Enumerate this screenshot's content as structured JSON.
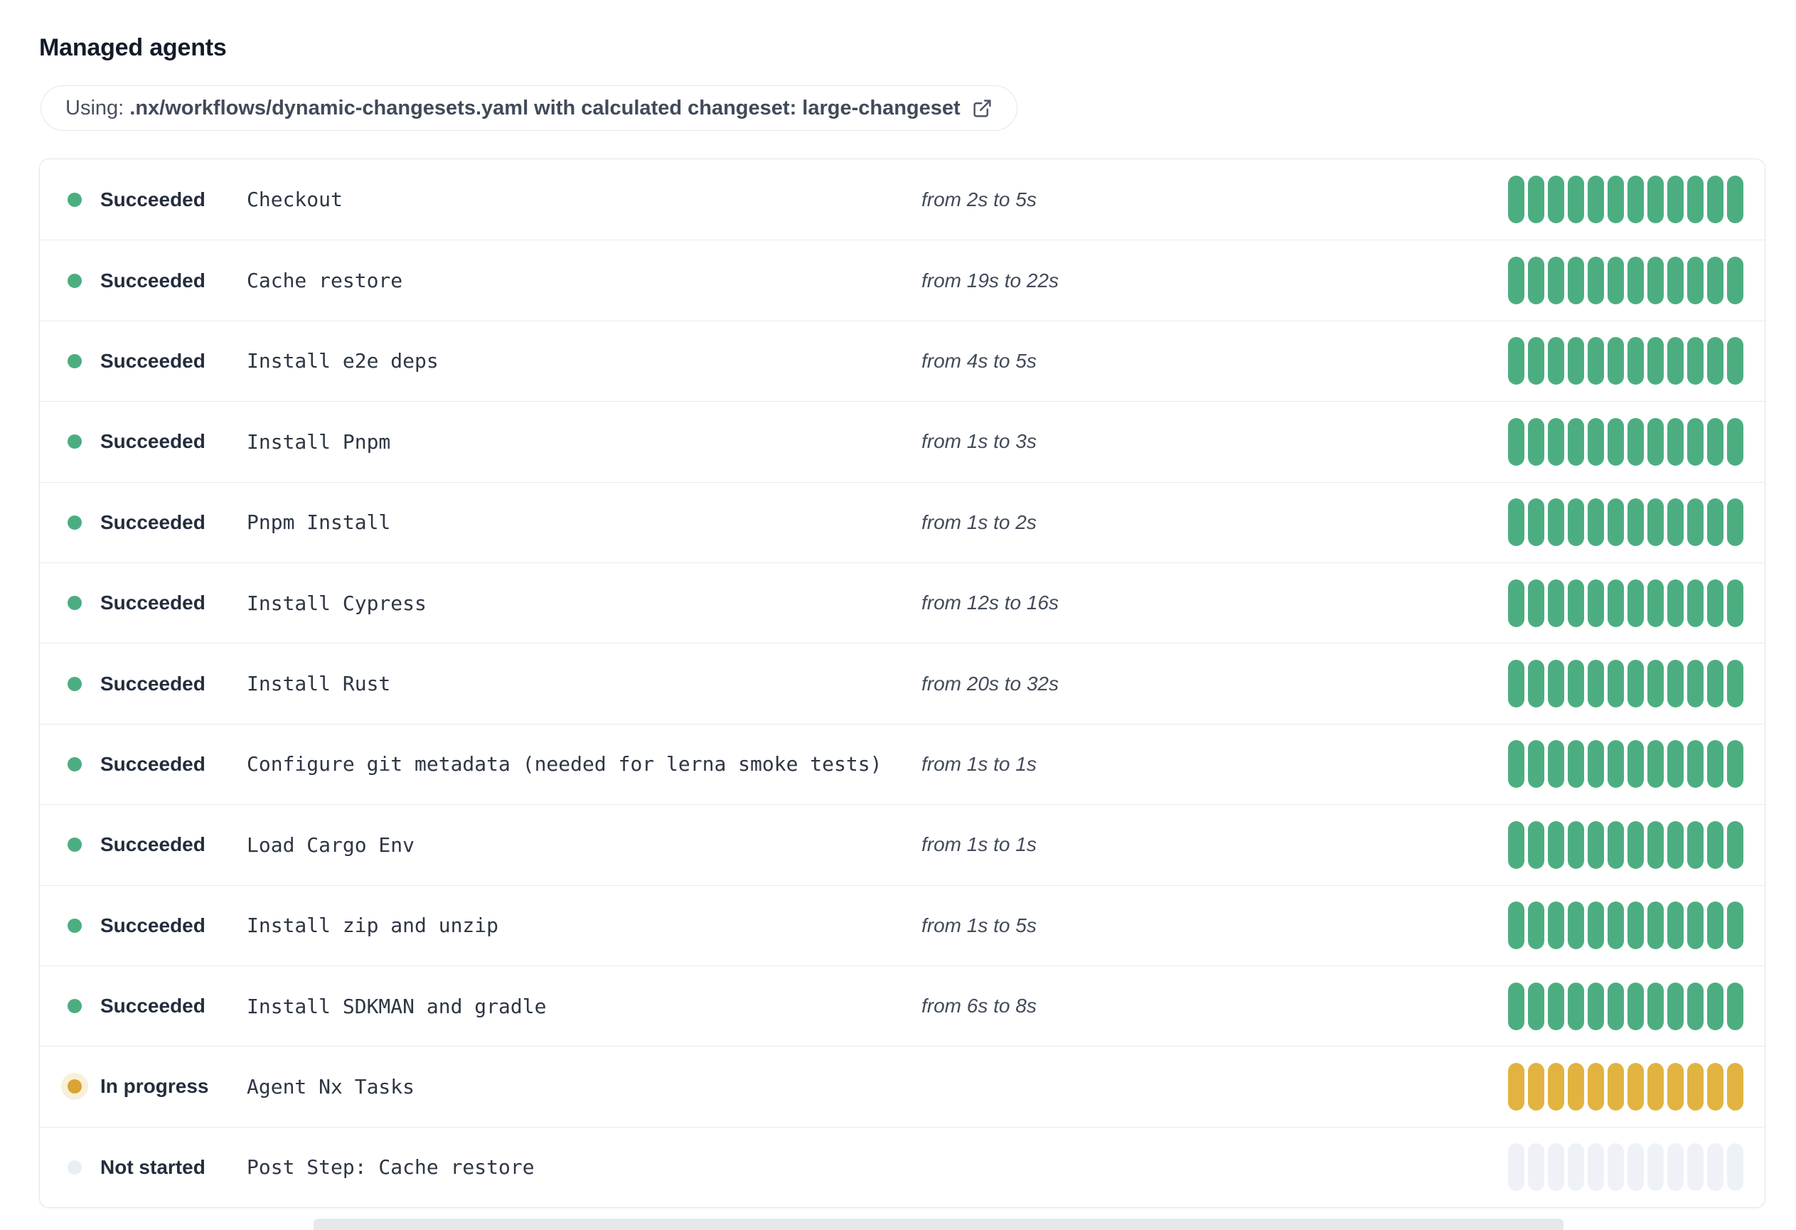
{
  "page": {
    "title": "Managed agents"
  },
  "banner": {
    "prefix": "Using: ",
    "highlight": ".nx/workflows/dynamic-changesets.yaml with calculated changeset: large-changeset",
    "icon": "external-link-icon"
  },
  "statuses": {
    "succeeded": {
      "label": "Succeeded",
      "color": "#4cae80"
    },
    "in_progress": {
      "label": "In progress",
      "color": "#e2b340",
      "dot_color": "#d9a432",
      "halo_color": "#f8f0d9"
    },
    "not_started": {
      "label": "Not started",
      "color": "#eef2f7",
      "dot_color": "#e9eef4"
    }
  },
  "progress": {
    "segments_per_bar": 12
  },
  "steps": [
    {
      "status_key": "succeeded",
      "status": "Succeeded",
      "name": "Checkout",
      "duration": "from 2s to 5s"
    },
    {
      "status_key": "succeeded",
      "status": "Succeeded",
      "name": "Cache restore",
      "duration": "from 19s to 22s"
    },
    {
      "status_key": "succeeded",
      "status": "Succeeded",
      "name": "Install e2e deps",
      "duration": "from 4s to 5s"
    },
    {
      "status_key": "succeeded",
      "status": "Succeeded",
      "name": "Install Pnpm",
      "duration": "from 1s to 3s"
    },
    {
      "status_key": "succeeded",
      "status": "Succeeded",
      "name": "Pnpm Install",
      "duration": "from 1s to 2s"
    },
    {
      "status_key": "succeeded",
      "status": "Succeeded",
      "name": "Install Cypress",
      "duration": "from 12s to 16s"
    },
    {
      "status_key": "succeeded",
      "status": "Succeeded",
      "name": "Install Rust",
      "duration": "from 20s to 32s"
    },
    {
      "status_key": "succeeded",
      "status": "Succeeded",
      "name": "Configure git metadata (needed for lerna smoke tests)",
      "duration": "from 1s to 1s"
    },
    {
      "status_key": "succeeded",
      "status": "Succeeded",
      "name": "Load Cargo Env",
      "duration": "from 1s to 1s"
    },
    {
      "status_key": "succeeded",
      "status": "Succeeded",
      "name": "Install zip and unzip",
      "duration": "from 1s to 5s"
    },
    {
      "status_key": "succeeded",
      "status": "Succeeded",
      "name": "Install SDKMAN and gradle",
      "duration": "from 6s to 8s"
    },
    {
      "status_key": "in_progress",
      "status": "In progress",
      "name": "Agent Nx Tasks",
      "duration": ""
    },
    {
      "status_key": "not_started",
      "status": "Not started",
      "name": "Post Step: Cache restore",
      "duration": ""
    }
  ]
}
